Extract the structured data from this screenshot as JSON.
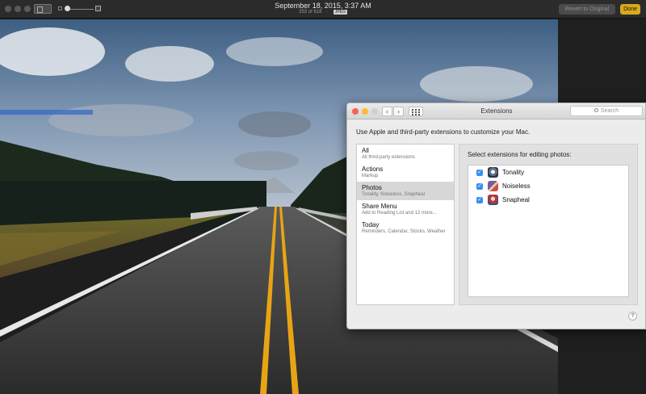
{
  "app": {
    "date_title": "September 18, 2015, 3:37 AM",
    "photo_position": "353 of 618",
    "separator": "·",
    "file_type": "JPEG",
    "revert_label": "Revert to Original",
    "done_label": "Done",
    "accent_color": "#d8a91c"
  },
  "prefs_window": {
    "title": "Extensions",
    "search_placeholder": "Search",
    "back_glyph": "‹",
    "forward_glyph": "›",
    "intro_text": "Use Apple and third-party extensions to customize your Mac.",
    "categories": [
      {
        "name": "All",
        "subtitle": "All third-party extensions",
        "selected": false
      },
      {
        "name": "Actions",
        "subtitle": "Markup",
        "selected": false
      },
      {
        "name": "Photos",
        "subtitle": "Tonality, Noiseless, Snapheal",
        "selected": true
      },
      {
        "name": "Share Menu",
        "subtitle": "Add to Reading List and 12 more...",
        "selected": false
      },
      {
        "name": "Today",
        "subtitle": "Reminders, Calendar, Stocks, Weather",
        "selected": false
      }
    ],
    "detail_heading": "Select extensions for editing photos:",
    "extensions": [
      {
        "name": "Tonality",
        "checked": true,
        "icon": "tonality-icon"
      },
      {
        "name": "Noiseless",
        "checked": true,
        "icon": "noiseless-icon"
      },
      {
        "name": "Snapheal",
        "checked": true,
        "icon": "snapheal-icon"
      }
    ],
    "checkmark": "✓",
    "help_label": "?"
  }
}
